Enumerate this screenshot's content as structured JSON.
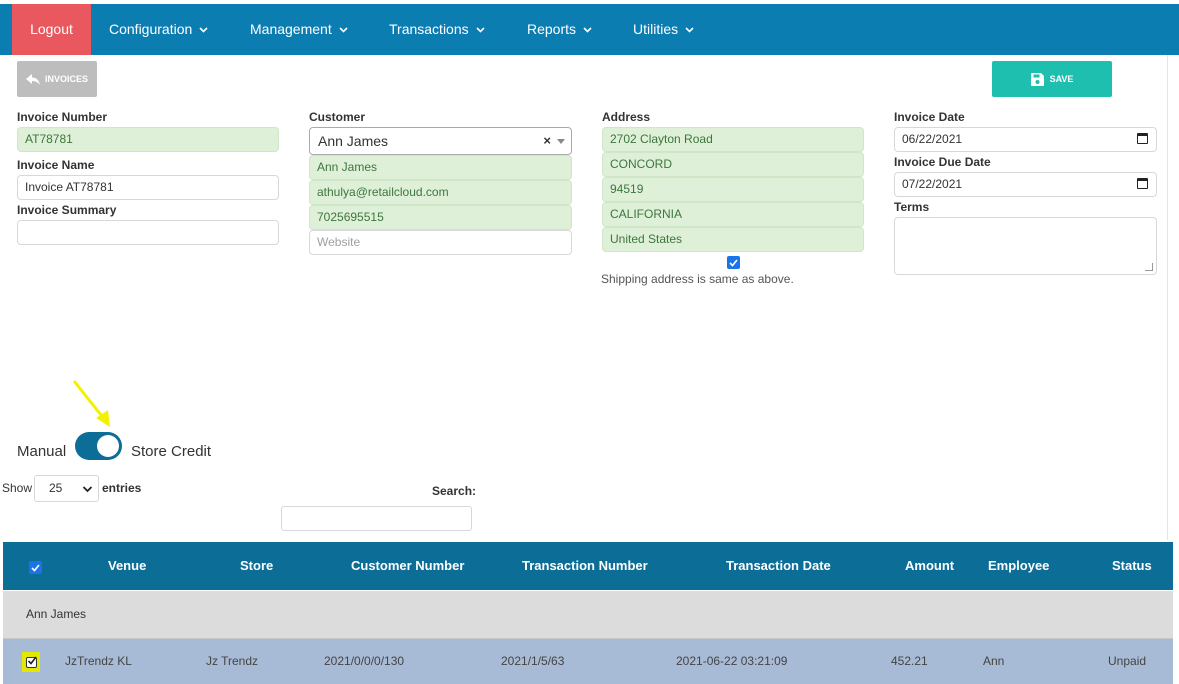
{
  "nav": {
    "logout": "Logout",
    "items": [
      {
        "label": "Configuration"
      },
      {
        "label": "Management"
      },
      {
        "label": "Transactions"
      },
      {
        "label": "Reports"
      },
      {
        "label": "Utilities"
      }
    ]
  },
  "toolbar": {
    "back_label": "INVOICES",
    "save_label": "SAVE"
  },
  "form": {
    "invoice_number_label": "Invoice Number",
    "invoice_number": "AT78781",
    "invoice_name_label": "Invoice Name",
    "invoice_name": "Invoice AT78781",
    "invoice_summary_label": "Invoice Summary",
    "invoice_summary": "",
    "customer_label": "Customer",
    "customer_selected": "Ann James",
    "customer_name": "Ann James",
    "customer_email": "athulya@retailcloud.com",
    "customer_phone": "7025695515",
    "website_placeholder": "Website",
    "address_label": "Address",
    "address_street": "2702 Clayton Road",
    "address_city": "CONCORD",
    "address_zip": "94519",
    "address_state": "CALIFORNIA",
    "address_country": "United States",
    "shipping_same_label": "Shipping address is same as above.",
    "shipping_same_checked": true,
    "invoice_date_label": "Invoice Date",
    "invoice_date": "06/22/2021",
    "invoice_due_date_label": "Invoice Due Date",
    "invoice_due_date": "07/22/2021",
    "terms_label": "Terms"
  },
  "toggle": {
    "left_label": "Manual",
    "right_label": "Store Credit",
    "on": true
  },
  "table_controls": {
    "show_label": "Show",
    "entries_value": "25",
    "entries_label": "entries",
    "search_label": "Search:"
  },
  "table": {
    "columns": [
      "Venue",
      "Store",
      "Customer Number",
      "Transaction Number",
      "Transaction Date",
      "Amount",
      "Employee",
      "Status"
    ],
    "group": "Ann James",
    "rows": [
      {
        "venue": "JzTrendz KL",
        "store": "Jz Trendz",
        "customer_number": "2021/0/0/0/130",
        "transaction_number": "2021/1/5/63",
        "transaction_date": "2021-06-22 03:21:09",
        "amount": "452.21",
        "employee": "Ann",
        "status": "Unpaid",
        "checked": true
      }
    ]
  },
  "colors": {
    "nav_bg": "#0c7db1",
    "logout_bg": "#e8585e",
    "save_bg": "#1ebfaf",
    "table_header_bg": "#0c6e96",
    "row_bg": "#a8bbd6",
    "annotation_arrow": "#f2f200"
  }
}
